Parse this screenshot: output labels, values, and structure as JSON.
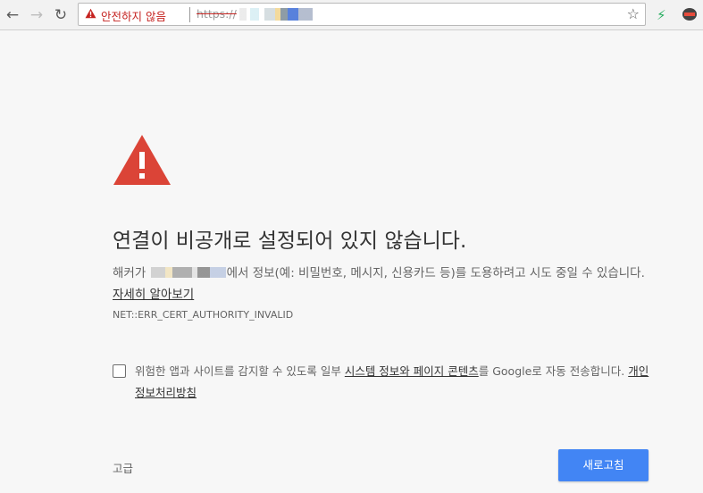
{
  "browser": {
    "security_label": "안전하지 않음",
    "url_scheme": "https://",
    "icons": [
      "back-icon",
      "forward-icon",
      "reload-icon",
      "warning-icon",
      "star-icon",
      "bolt-icon",
      "mask-icon"
    ]
  },
  "interstitial": {
    "heading": "연결이 비공개로 설정되어 있지 않습니다.",
    "desc_prefix": "해커가",
    "desc_suffix": "에서 정보(예: 비밀번호, 메시지, 신용카드 등)를 도용하려고 시도 중일 수 있습니다.",
    "learn_more": "자세히 알아보기",
    "error_code": "NET::ERR_CERT_AUTHORITY_INVALID",
    "optin_prefix": "위험한 앱과 사이트를 감지할 수 있도록 일부",
    "optin_link": "시스템 정보와 페이지 콘텐츠",
    "optin_middle": "를 Google로 자동 전송합니다.",
    "privacy_link": "개인정보처리방침",
    "advanced": "고급",
    "reload": "새로고침"
  },
  "colors": {
    "danger": "#db4437",
    "button": "#4285f4",
    "insecure_text": "#c5221f"
  }
}
